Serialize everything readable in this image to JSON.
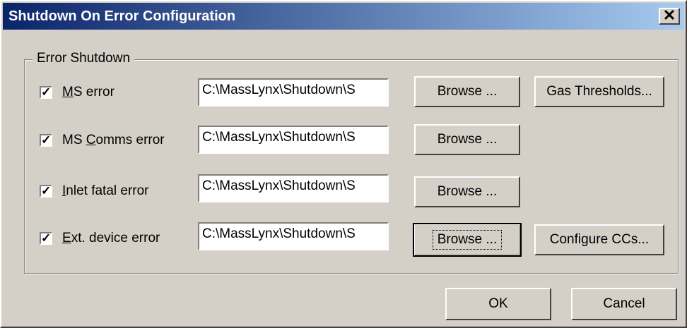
{
  "window": {
    "title": "Shutdown On Error Configuration",
    "close_glyph": "✕"
  },
  "group": {
    "label": "Error Shutdown"
  },
  "rows": [
    {
      "checked": true,
      "label_pre": "",
      "label_ul": "M",
      "label_post": "S error",
      "path": "C:\\MassLynx\\Shutdown\\S",
      "browse": "Browse ..."
    },
    {
      "checked": true,
      "label_pre": "MS ",
      "label_ul": "C",
      "label_post": "omms error",
      "path": "C:\\MassLynx\\Shutdown\\S",
      "browse": "Browse ..."
    },
    {
      "checked": true,
      "label_pre": "",
      "label_ul": "I",
      "label_post": "nlet fatal error",
      "path": "C:\\MassLynx\\Shutdown\\S",
      "browse": "Browse ..."
    },
    {
      "checked": true,
      "label_pre": "",
      "label_ul": "E",
      "label_post": "xt. device error",
      "path": "C:\\MassLynx\\Shutdown\\S",
      "browse": "Browse ..."
    }
  ],
  "buttons": {
    "gas_thresholds": "Gas Thresholds...",
    "configure_ccs": "Configure CCs...",
    "ok": "OK",
    "cancel": "Cancel"
  },
  "check_glyph": "✓"
}
